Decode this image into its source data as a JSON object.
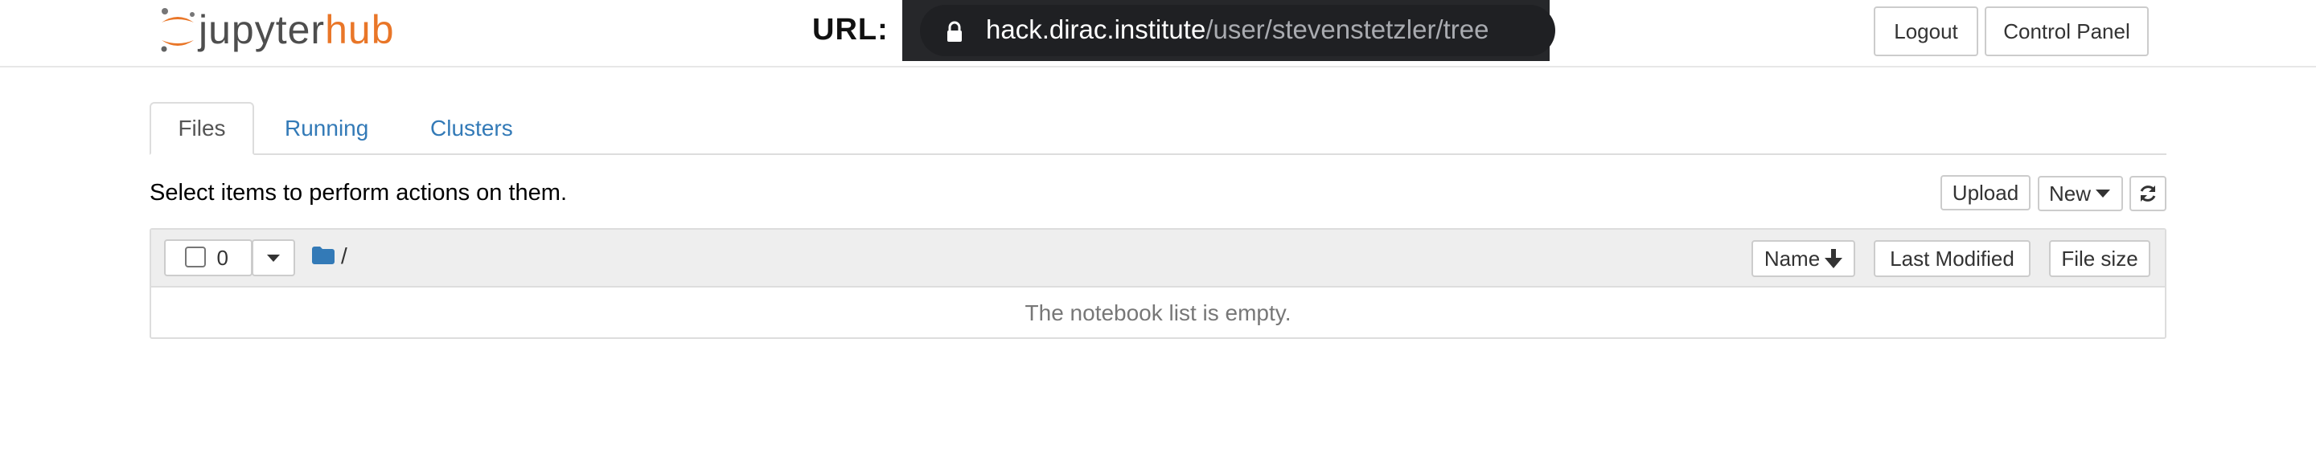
{
  "header": {
    "logo_jupyter": "jupyter",
    "logo_hub": "hub",
    "url_label": "URL:",
    "url_domain": "hack.dirac.institute",
    "url_path": "/user/stevenstetzler/tree",
    "logout_label": "Logout",
    "control_panel_label": "Control Panel"
  },
  "tabs": [
    {
      "label": "Files",
      "active": true
    },
    {
      "label": "Running",
      "active": false
    },
    {
      "label": "Clusters",
      "active": false
    }
  ],
  "toolbar": {
    "hint": "Select items to perform actions on them.",
    "upload_label": "Upload",
    "new_label": "New"
  },
  "file_list": {
    "selected_count": "0",
    "breadcrumb_path": "/",
    "sort_name_label": "Name",
    "sort_modified_label": "Last Modified",
    "sort_size_label": "File size",
    "empty_message": "The notebook list is empty."
  },
  "colors": {
    "brand_orange": "#e97628",
    "link_blue": "#337ab7",
    "url_bar_bg": "#26272a"
  }
}
